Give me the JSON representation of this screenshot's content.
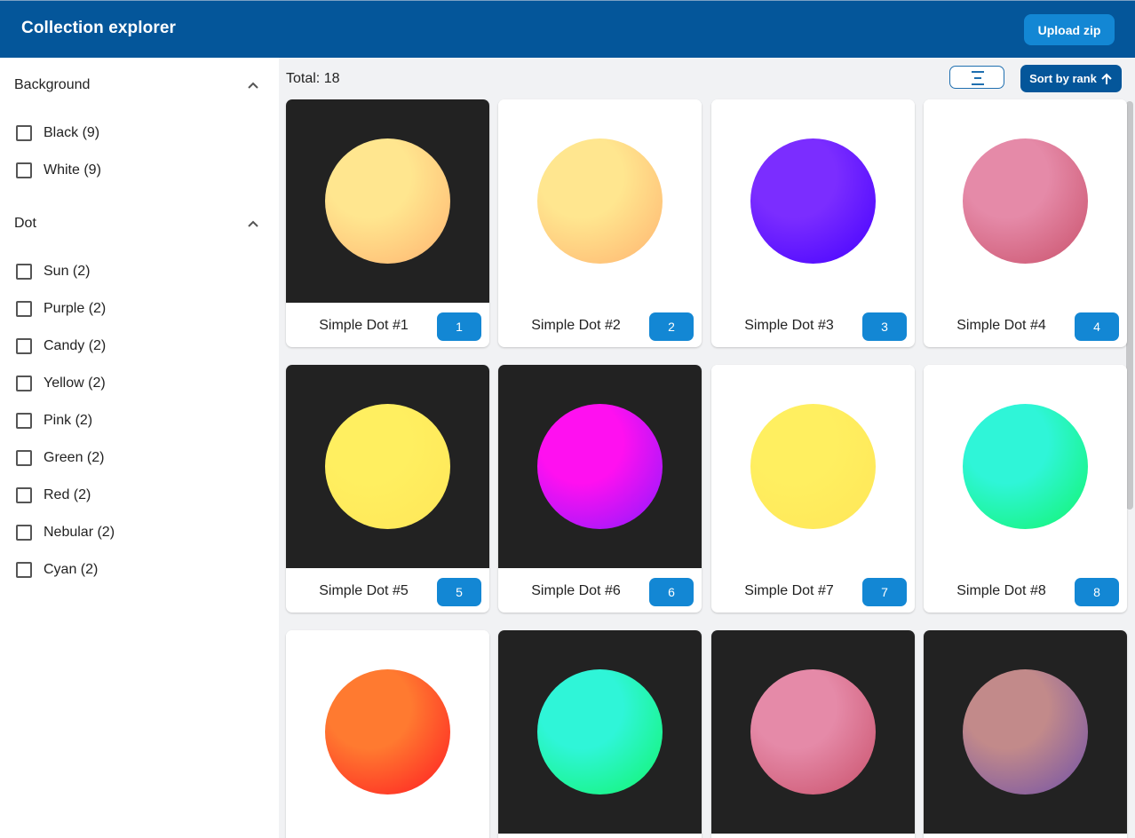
{
  "app": {
    "title": "Collection explorer",
    "upload_label": "Upload zip"
  },
  "filters": [
    {
      "title": "Background",
      "options": [
        {
          "label": "Black (9)"
        },
        {
          "label": "White (9)"
        }
      ]
    },
    {
      "title": "Dot",
      "options": [
        {
          "label": "Sun (2)"
        },
        {
          "label": "Purple (2)"
        },
        {
          "label": "Candy (2)"
        },
        {
          "label": "Yellow (2)"
        },
        {
          "label": "Pink (2)"
        },
        {
          "label": "Green (2)"
        },
        {
          "label": "Red (2)"
        },
        {
          "label": "Nebular (2)"
        },
        {
          "label": "Cyan (2)"
        }
      ]
    }
  ],
  "toolbar": {
    "total": "Total: 18",
    "sort_label": "Sort by rank"
  },
  "colors": {
    "appbar": "#04569a",
    "accent": "#1387d4",
    "black_bg": "#222222",
    "white_bg": "#ffffff"
  },
  "items": [
    {
      "name": "Simple Dot #1",
      "rank": "1",
      "bg": "#222222",
      "dot": [
        "#ffe68f",
        "#ffb370"
      ]
    },
    {
      "name": "Simple Dot #2",
      "rank": "2",
      "bg": "#ffffff",
      "dot": [
        "#ffe68f",
        "#ffb370"
      ]
    },
    {
      "name": "Simple Dot #3",
      "rank": "3",
      "bg": "#ffffff",
      "dot": [
        "#7b2dff",
        "#4400ff"
      ]
    },
    {
      "name": "Simple Dot #4",
      "rank": "4",
      "bg": "#ffffff",
      "dot": [
        "#e58aa8",
        "#c9506a"
      ]
    },
    {
      "name": "Simple Dot #5",
      "rank": "5",
      "bg": "#222222",
      "dot": [
        "#ffef60",
        "#ffe658"
      ]
    },
    {
      "name": "Simple Dot #6",
      "rank": "6",
      "bg": "#222222",
      "dot": [
        "#ff10f0",
        "#8a1aff"
      ]
    },
    {
      "name": "Simple Dot #7",
      "rank": "7",
      "bg": "#ffffff",
      "dot": [
        "#ffef60",
        "#ffe658"
      ]
    },
    {
      "name": "Simple Dot #8",
      "rank": "8",
      "bg": "#ffffff",
      "dot": [
        "#2ff5d8",
        "#12f56a"
      ]
    },
    {
      "name": "",
      "rank": "",
      "bg": "#ffffff",
      "dot": [
        "#ff7a30",
        "#ff1a22"
      ]
    },
    {
      "name": "",
      "rank": "",
      "bg": "#222222",
      "dot": [
        "#2ff5d8",
        "#12f56a"
      ]
    },
    {
      "name": "",
      "rank": "",
      "bg": "#222222",
      "dot": [
        "#e58aa8",
        "#c9506a"
      ]
    },
    {
      "name": "",
      "rank": "",
      "bg": "#222222",
      "dot": [
        "#c28a8a",
        "#7050a8"
      ]
    }
  ]
}
